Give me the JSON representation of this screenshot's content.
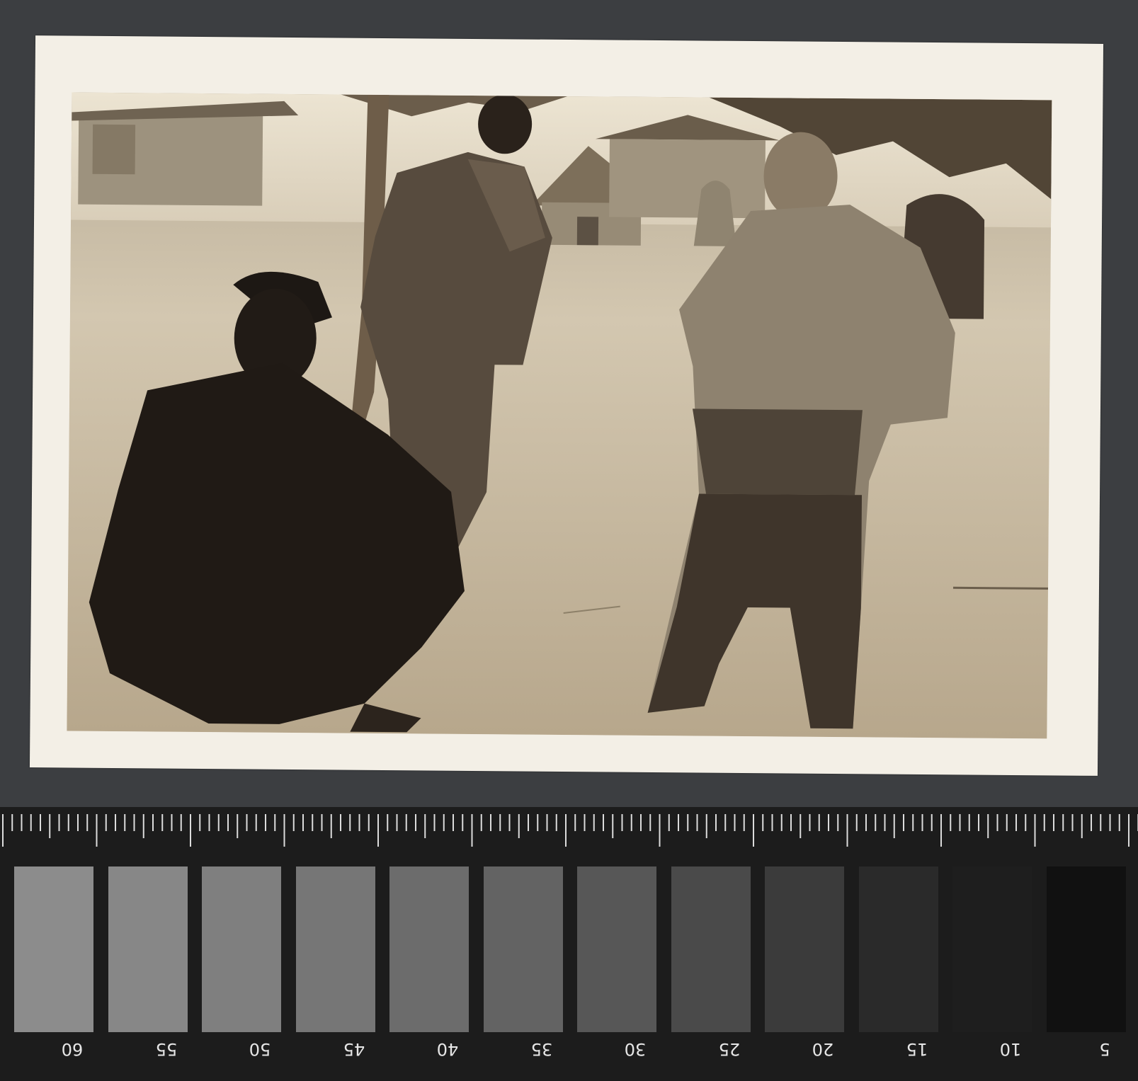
{
  "photo": {
    "subject": "vintage black-and-white photograph",
    "tone_colors": {
      "sky": "#e9e1cf",
      "ground": "#c7b99f",
      "shadow": "#1f1a16"
    }
  },
  "scale": {
    "labels": [
      "60",
      "55",
      "50",
      "45",
      "40",
      "35",
      "30",
      "25",
      "20",
      "15",
      "10",
      "5"
    ],
    "patch_colors": [
      "#8c8c8c",
      "#878787",
      "#7f7f7f",
      "#767676",
      "#6c6c6c",
      "#636363",
      "#575757",
      "#4a4a4a",
      "#3b3b3b",
      "#2a2a2a",
      "#1e1e1e",
      "#111111"
    ]
  }
}
